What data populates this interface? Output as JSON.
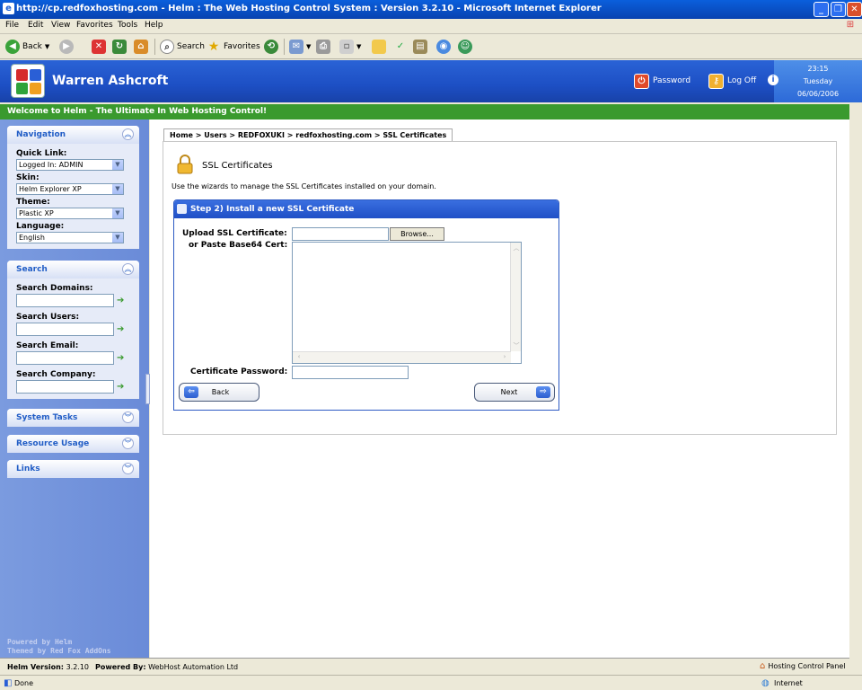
{
  "window": {
    "title": "http://cp.redfoxhosting.com - Helm : The Web Hosting Control System : Version 3.2.10 - Microsoft Internet Explorer"
  },
  "menu": [
    "File",
    "Edit",
    "View",
    "Favorites",
    "Tools",
    "Help"
  ],
  "toolbar": {
    "back": "Back",
    "search": "Search",
    "favorites": "Favorites"
  },
  "header": {
    "user": "Warren Ashcroft",
    "password_label": "Password",
    "logoff_label": "Log Off",
    "time": "23:15",
    "day": "Tuesday",
    "date": "06/06/2006"
  },
  "welcome": "Welcome to Helm - The Ultimate In Web Hosting Control!",
  "sidebar": {
    "navigation": {
      "title": "Navigation",
      "quick_link_label": "Quick Link:",
      "quick_link_value": "Logged In: ADMIN",
      "skin_label": "Skin:",
      "skin_value": "Helm Explorer XP",
      "theme_label": "Theme:",
      "theme_value": "Plastic XP",
      "language_label": "Language:",
      "language_value": "English"
    },
    "search": {
      "title": "Search",
      "domains": "Search Domains:",
      "users": "Search Users:",
      "email": "Search Email:",
      "company": "Search Company:"
    },
    "system_tasks": "System Tasks",
    "resource_usage": "Resource Usage",
    "links": "Links",
    "powered": "Powered by Helm",
    "themed": "Themed by Red Fox AddOns"
  },
  "breadcrumb": "Home > Users > REDFOXUKI > redfoxhosting.com > SSL Certificates",
  "page": {
    "title": "SSL Certificates",
    "description": "Use the wizards to manage the SSL Certificates installed on your domain."
  },
  "wizard": {
    "title": "Step 2) Install a new SSL Certificate",
    "upload_label": "Upload SSL Certificate:",
    "paste_label": "or Paste Base64 Cert:",
    "browse": "Browse...",
    "password_label": "Certificate Password:",
    "back": "Back",
    "next": "Next"
  },
  "footer": {
    "version_label": "Helm Version:",
    "version": "3.2.10",
    "powered_label": "Powered By:",
    "powered": "WebHost Automation Ltd",
    "panel": "Hosting Control Panel"
  },
  "status": {
    "text": "Done",
    "zone": "Internet"
  }
}
